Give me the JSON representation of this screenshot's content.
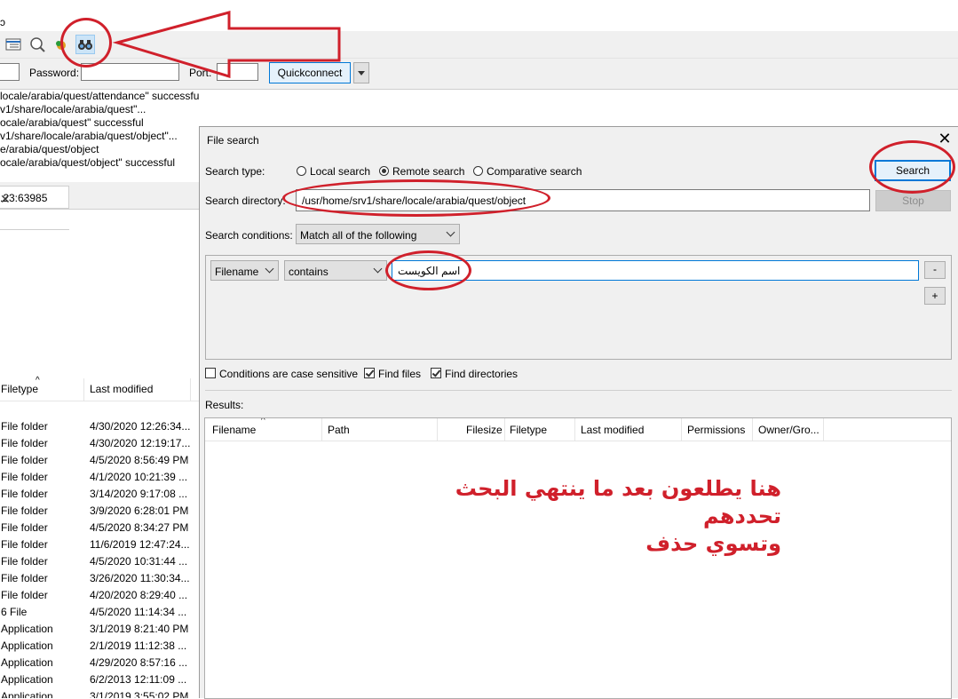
{
  "background_app": {
    "toolbar_icons": [
      "queue-view-icon",
      "search-file-icon",
      "refresh-icon",
      "binoculars-icon"
    ],
    "quickconnect": {
      "password_label": "Password:",
      "port_label": "Port:",
      "button_label": "Quickconnect"
    },
    "log_lines": [
      "locale/arabia/quest/attendance\" successful",
      "v1/share/locale/arabia/quest\"...",
      "ocale/arabia/quest\" successful",
      "v1/share/locale/arabia/quest/object\"...",
      "e/arabia/quest/object",
      "ocale/arabia/quest/object\" successful"
    ],
    "tab_label": ".23:63985",
    "list_columns": {
      "filetype": "Filetype",
      "last_modified": "Last modified"
    },
    "files": [
      {
        "type": "File folder",
        "modified": "4/30/2020 12:26:34..."
      },
      {
        "type": "File folder",
        "modified": "4/30/2020 12:19:17..."
      },
      {
        "type": "File folder",
        "modified": "4/5/2020 8:56:49 PM"
      },
      {
        "type": "File folder",
        "modified": "4/1/2020 10:21:39 ..."
      },
      {
        "type": "File folder",
        "modified": "3/14/2020 9:17:08 ..."
      },
      {
        "type": "File folder",
        "modified": "3/9/2020 6:28:01 PM"
      },
      {
        "type": "File folder",
        "modified": "4/5/2020 8:34:27 PM"
      },
      {
        "type": "File folder",
        "modified": "11/6/2019 12:47:24..."
      },
      {
        "type": "File folder",
        "modified": "4/5/2020 10:31:44 ..."
      },
      {
        "type": "File folder",
        "modified": "3/26/2020 11:30:34..."
      },
      {
        "type": "File folder",
        "modified": "4/20/2020 8:29:40 ..."
      },
      {
        "type": "6 File",
        "modified": "4/5/2020 11:14:34 ..."
      },
      {
        "type": "Application",
        "modified": "3/1/2019 8:21:40 PM"
      },
      {
        "type": "Application",
        "modified": "2/1/2019 11:12:38 ..."
      },
      {
        "type": "Application",
        "modified": "4/29/2020 8:57:16 ..."
      },
      {
        "type": "Application",
        "modified": "6/2/2013 12:11:09 ..."
      },
      {
        "type": "Application",
        "modified": "3/1/2019 3:55:02 PM"
      }
    ]
  },
  "dialog": {
    "title": "File search",
    "search_type_label": "Search type:",
    "search_types": [
      {
        "label": "Local search",
        "selected": false
      },
      {
        "label": "Remote search",
        "selected": true
      },
      {
        "label": "Comparative search",
        "selected": false
      }
    ],
    "search_button": "Search",
    "stop_button": "Stop",
    "search_directory_label": "Search directory:",
    "search_directory_value": "/usr/home/srv1/share/locale/arabia/quest/object",
    "search_conditions_label": "Search conditions:",
    "search_conditions_value": "Match all of the following",
    "condition": {
      "field": "Filename",
      "operator": "contains",
      "value": "اسم الكويست"
    },
    "remove_condition": "-",
    "add_condition": "+",
    "case_sensitive_label": "Conditions are case sensitive",
    "case_sensitive_checked": false,
    "find_files_label": "Find files",
    "find_files_checked": true,
    "find_directories_label": "Find directories",
    "find_directories_checked": true,
    "results_label": "Results:",
    "result_columns": [
      "Filename",
      "Path",
      "Filesize",
      "Filetype",
      "Last modified",
      "Permissions",
      "Owner/Gro..."
    ]
  },
  "annotation": {
    "note_line1": "هنا يطلعون بعد ما ينتهي البحث تحددهم",
    "note_line2": "وتسوي حذف",
    "color": "#d0202b"
  }
}
